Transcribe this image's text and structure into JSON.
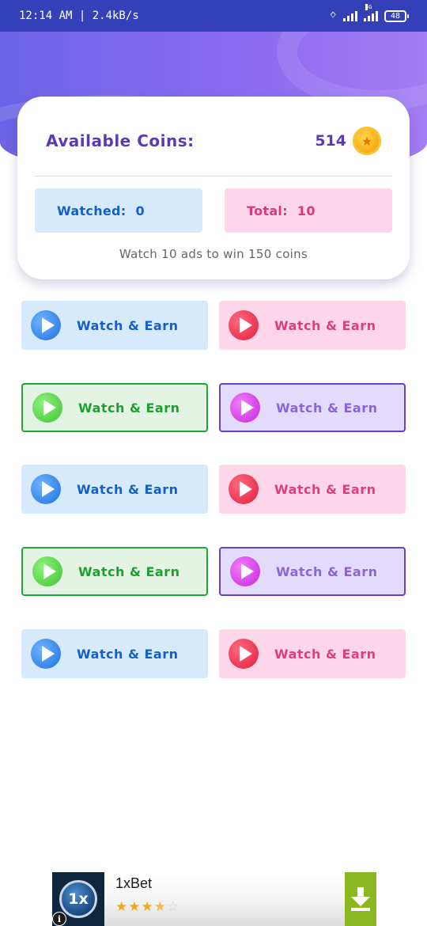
{
  "status_bar": {
    "time_speed": "12:14 AM | 2.4kB/s",
    "network_tag": "4G",
    "battery": "48",
    "icons": [
      "bluetooth-icon",
      "signal-icon",
      "signal-4g-icon",
      "battery-icon"
    ]
  },
  "coins": {
    "label": "Available Coins:",
    "value": "514",
    "icon": "coin-icon"
  },
  "stats": {
    "watched_label": "Watched:",
    "watched_value": "0",
    "total_label": "Total:",
    "total_value": "10"
  },
  "hint": "Watch 10 ads to win 150 coins",
  "buttons": [
    {
      "label": "Watch & Earn",
      "color": "blue"
    },
    {
      "label": "Watch & Earn",
      "color": "pink"
    },
    {
      "label": "Watch & Earn",
      "color": "green"
    },
    {
      "label": "Watch & Earn",
      "color": "violet"
    },
    {
      "label": "Watch & Earn",
      "color": "blue"
    },
    {
      "label": "Watch & Earn",
      "color": "pink"
    },
    {
      "label": "Watch & Earn",
      "color": "green"
    },
    {
      "label": "Watch & Earn",
      "color": "violet"
    },
    {
      "label": "Watch & Earn",
      "color": "blue"
    },
    {
      "label": "Watch & Earn",
      "color": "pink"
    }
  ],
  "ad": {
    "logo_text": "1x",
    "title": "1xBet",
    "rating": 3.5,
    "info_glyph": "i",
    "icons": [
      "ad-info-icon",
      "download-icon"
    ]
  },
  "colors": {
    "header": "#7a68ea",
    "accent_text": "#5c3bb0",
    "blue": "#1460c8",
    "pink": "#de3f7c",
    "green": "#1ea02c",
    "violet": "#8a64d8",
    "ad_download": "#8ab821"
  }
}
